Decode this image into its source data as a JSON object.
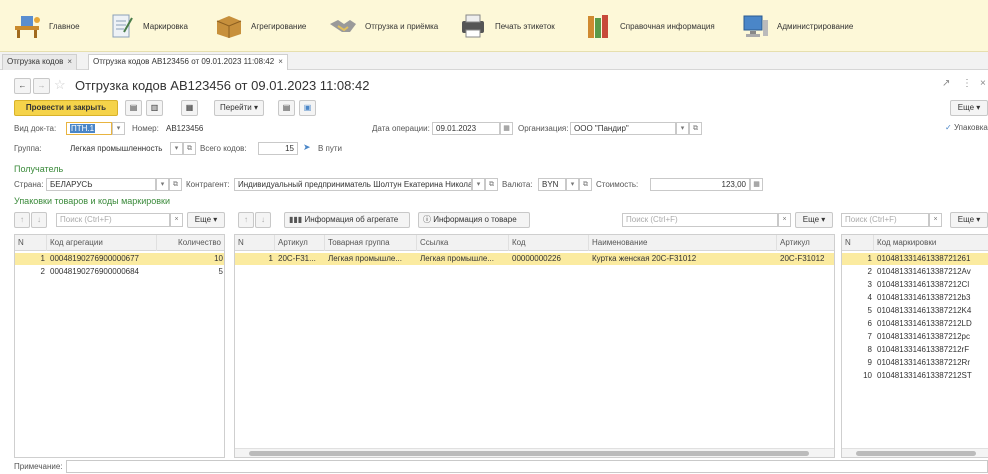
{
  "sections": [
    {
      "label": "Главное",
      "icon": "desk-icon",
      "color": "#e8a838"
    },
    {
      "label": "Маркировка",
      "icon": "notepad-icon",
      "color": "#9bb0c8"
    },
    {
      "label": "Агрегирование",
      "icon": "box-icon",
      "color": "#c7903c"
    },
    {
      "label": "Отгрузка и приёмка",
      "icon": "handshake-icon",
      "color": "#8c8c8c"
    },
    {
      "label": "Печать этикеток",
      "icon": "printer-icon",
      "color": "#555555"
    },
    {
      "label": "Справочная информация",
      "icon": "books-icon",
      "color": "#d08a30"
    },
    {
      "label": "Администрирование",
      "icon": "computer-icon",
      "color": "#4a86c8"
    }
  ],
  "tabs": {
    "t1": "Отгрузка кодов",
    "t2": "Отгрузка кодов АВ123456 от 09.01.2023 11:08:42",
    "close": "×"
  },
  "doc": {
    "title": "Отгрузка кодов АВ123456 от 09.01.2023 11:08:42"
  },
  "toolbar": {
    "post_close": "Провести и закрыть",
    "goto": "Перейти",
    "more": "Еще"
  },
  "form": {
    "doc_type_label": "Вид док-та:",
    "doc_type": "ПТН.1",
    "number_label": "Номер:",
    "number": "AB123456",
    "op_date_label": "Дата операции:",
    "op_date": "09.01.2023",
    "org_label": "Организация:",
    "org": "ООО \"Пандир\"",
    "pack_label": "Упаковка",
    "group_label": "Группа:",
    "group": "Легкая промышленность",
    "total_label": "Всего кодов:",
    "total": "15",
    "status": "В пути",
    "recipient_header": "Получатель",
    "country_label": "Страна:",
    "country": "БЕЛАРУСЬ",
    "contractor_label": "Контрагент:",
    "contractor": "Индивидуальный предприниматель Шолтун Екатерина Николае",
    "currency_label": "Валюта:",
    "currency": "BYN",
    "cost_label": "Стоимость:",
    "cost": "123,00",
    "packs_header": "Упаковки товаров и коды маркировки",
    "note_label": "Примечание:"
  },
  "search": {
    "ph": "Поиск (Ctrl+F)",
    "more": "Еще",
    "agg_info": "Информация об агрегате",
    "goods_info": "Информация о товаре",
    "clear": "×"
  },
  "agg": {
    "cols": [
      "N",
      "Код агрегации",
      "Количество"
    ],
    "rows": [
      [
        "1",
        "00048190276900000677",
        "10"
      ],
      [
        "2",
        "00048190276900000684",
        "5"
      ]
    ]
  },
  "goods": {
    "cols": [
      "N",
      "Артикул",
      "Товарная группа",
      "Ссылка",
      "Код",
      "Наименование",
      "Артикул"
    ],
    "rows": [
      [
        "1",
        "20С-F31...",
        "Легкая промышле...",
        "Легкая промышле...",
        "00000000226",
        "Куртка женская 20С-F31012",
        "20С-F31012"
      ]
    ]
  },
  "marks": {
    "cols": [
      "N",
      "Код маркировки"
    ],
    "rows": [
      [
        "1",
        "010481331461338721261"
      ],
      [
        "2",
        "0104813314613387212Av"
      ],
      [
        "3",
        "0104813314613387212Cl"
      ],
      [
        "4",
        "0104813314613387212b3"
      ],
      [
        "5",
        "0104813314613387212K4"
      ],
      [
        "6",
        "0104813314613387212LD"
      ],
      [
        "7",
        "0104813314613387212pc"
      ],
      [
        "8",
        "0104813314613387212rF"
      ],
      [
        "9",
        "0104813314613387212Rr"
      ],
      [
        "10",
        "0104813314613387212ST"
      ]
    ]
  }
}
